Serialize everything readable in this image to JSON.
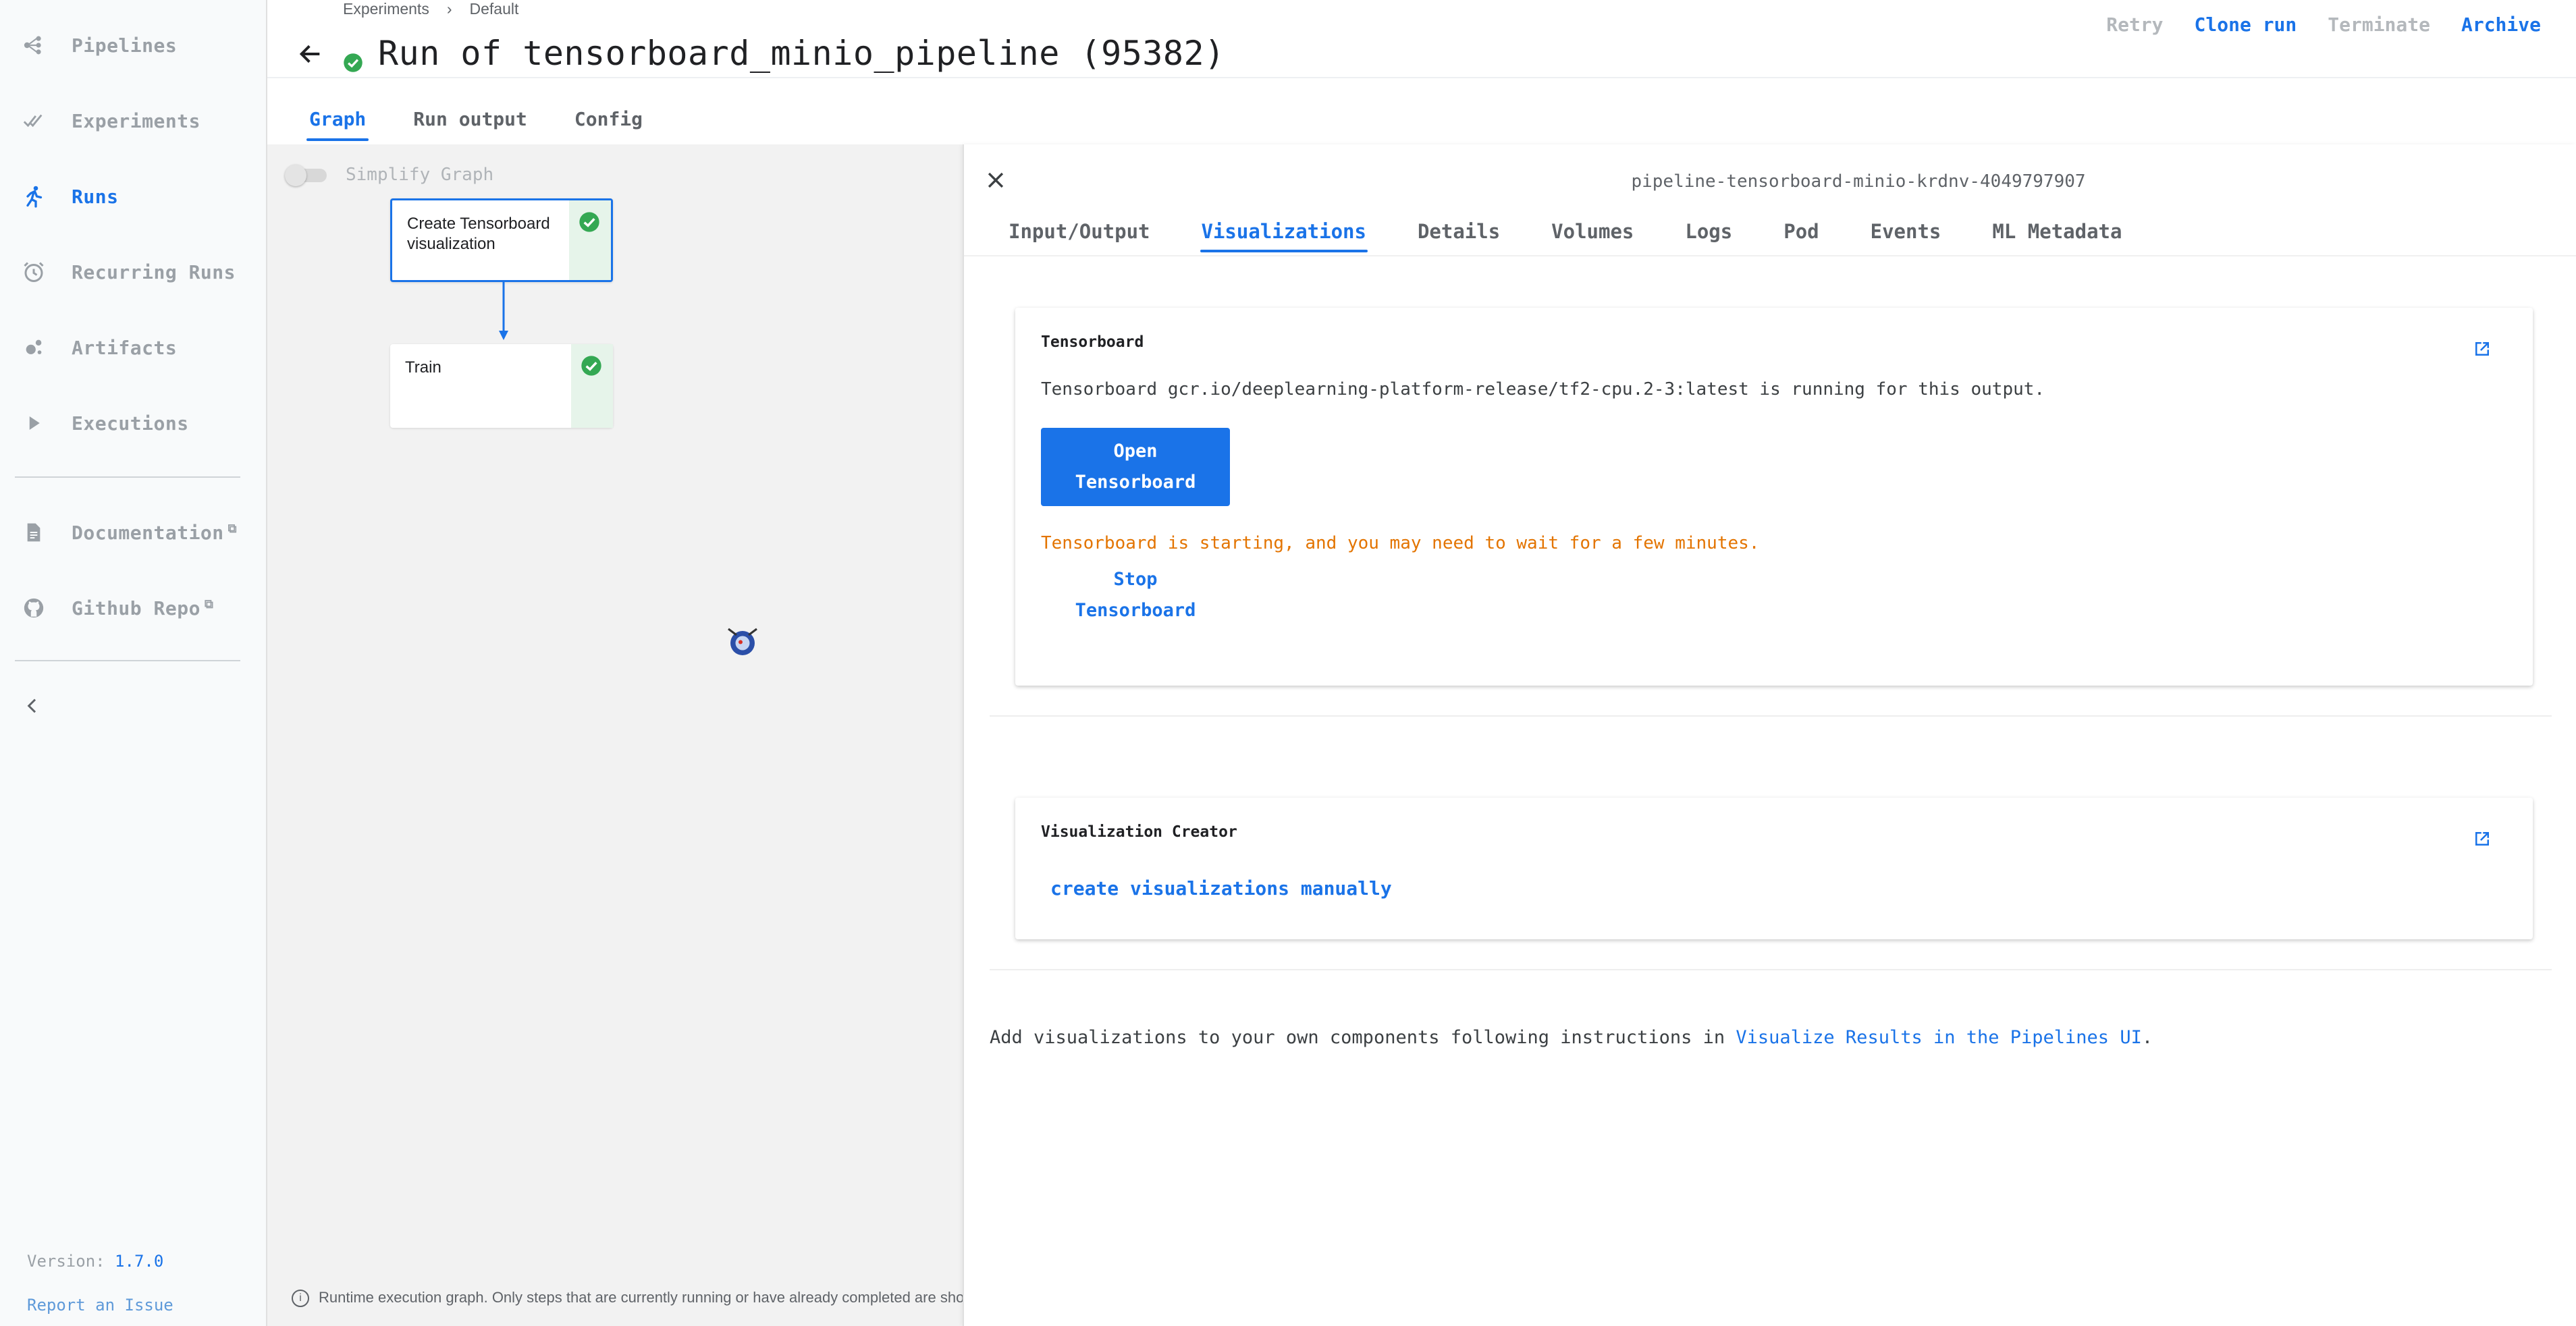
{
  "sidebar": {
    "items": [
      {
        "label": "Pipelines",
        "icon": "pipelines-icon"
      },
      {
        "label": "Experiments",
        "icon": "experiments-icon"
      },
      {
        "label": "Runs",
        "icon": "runs-icon",
        "active": true
      },
      {
        "label": "Recurring Runs",
        "icon": "recurring-runs-icon"
      },
      {
        "label": "Artifacts",
        "icon": "artifacts-icon"
      },
      {
        "label": "Executions",
        "icon": "executions-icon"
      },
      {
        "label": "Documentation",
        "icon": "documentation-icon",
        "external": true
      },
      {
        "label": "Github Repo",
        "icon": "github-icon",
        "external": true
      }
    ],
    "version_label": "Version:",
    "version": "1.7.0",
    "report_issue": "Report an Issue"
  },
  "breadcrumb": {
    "items": [
      "Experiments",
      "Default"
    ],
    "separator": "›"
  },
  "header": {
    "title": "Run of tensorboard_minio_pipeline (95382)",
    "actions": {
      "retry": "Retry",
      "clone": "Clone run",
      "terminate": "Terminate",
      "archive": "Archive"
    }
  },
  "main_tabs": [
    "Graph",
    "Run output",
    "Config"
  ],
  "graph": {
    "simplify_label": "Simplify Graph",
    "nodes": [
      "Create Tensorboard visualization",
      "Train"
    ],
    "footnote": "Runtime execution graph. Only steps that are currently running or have already completed are shown."
  },
  "side_panel": {
    "title": "pipeline-tensorboard-minio-krdnv-4049797907",
    "tabs": [
      "Input/Output",
      "Visualizations",
      "Details",
      "Volumes",
      "Logs",
      "Pod",
      "Events",
      "ML Metadata"
    ],
    "tensorboard_card": {
      "title": "Tensorboard",
      "description": "Tensorboard gcr.io/deeplearning-platform-release/tf2-cpu.2-3:latest is running for this output.",
      "open_line1": "Open",
      "open_line2": "Tensorboard",
      "warning": "Tensorboard is starting, and you may need to wait for a few minutes.",
      "stop_line1": "Stop",
      "stop_line2": "Tensorboard"
    },
    "creator_card": {
      "title": "Visualization Creator",
      "link": "create visualizations manually"
    },
    "help_text": "Add visualizations to your own components following instructions in ",
    "help_link": "Visualize Results in the Pipelines UI",
    "help_end": "."
  },
  "colors": {
    "accent": "#1a73e8",
    "warning": "#e37400",
    "success": "#34a853"
  }
}
